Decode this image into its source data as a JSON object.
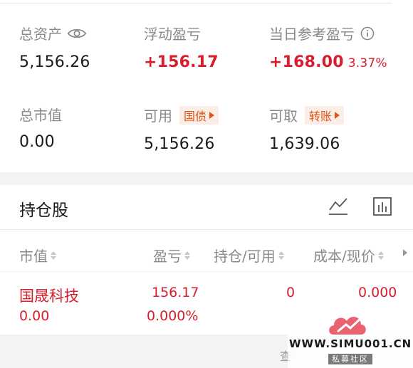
{
  "summary": {
    "total_assets": {
      "label": "总资产",
      "value": "5,156.26"
    },
    "floating_pl": {
      "label": "浮动盈亏",
      "value": "+156.17"
    },
    "today_pl": {
      "label": "当日参考盈亏",
      "value": "+168.00",
      "pct": "3.37%"
    },
    "market_value": {
      "label": "总市值",
      "value": "0.00"
    },
    "available": {
      "label": "可用",
      "value": "5,156.26",
      "chip": "国债"
    },
    "withdrawable": {
      "label": "可取",
      "value": "1,639.06",
      "chip": "转账"
    }
  },
  "holdings": {
    "title": "持仓股",
    "columns": [
      "市值",
      "盈亏",
      "持仓/可用",
      "成本/现价"
    ],
    "rows": [
      {
        "name": "国晟科技",
        "market_value": "0.00",
        "pl": "156.17",
        "pl_pct": "0.000%",
        "position": "0",
        "cost": "0.000"
      }
    ]
  },
  "footer": {
    "partial_text": "查"
  },
  "watermark": {
    "site": "WWW.SIMU001.CN",
    "tag": "私募社区"
  },
  "colors": {
    "red": "#d81e2c",
    "orange": "#e2541a",
    "label_gray": "#8a8a8a"
  },
  "icons": [
    "eye-icon",
    "info-icon",
    "line-chart-icon",
    "bar-chart-icon"
  ]
}
